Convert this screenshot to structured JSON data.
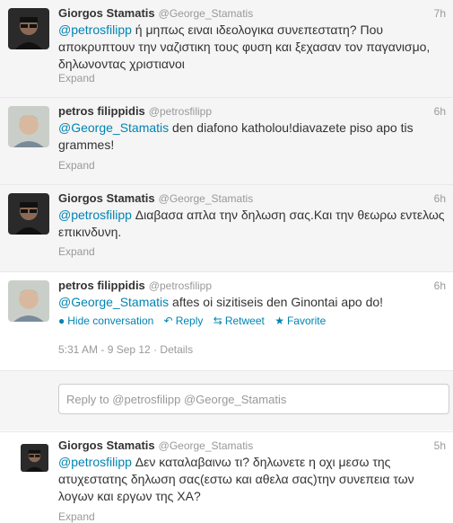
{
  "tweets": [
    {
      "name": "Giorgos Stamatis",
      "handle": "@George_Stamatis",
      "time": "7h",
      "mention": "@petrosfilipp",
      "text": " ή μηπως ειναι ιδεολογικα συνεπεστατη? Που αποκρυπτουν την ναζιστικη τους φυση και ξεχασαν τον παγανισμο, δηλωνοντας χριστιανοι",
      "expand": "Expand"
    },
    {
      "name": "petros filippidis",
      "handle": "@petrosfilipp",
      "time": "6h",
      "mention": "@George_Stamatis",
      "text": " den diafono katholou!diavazete piso apo tis grammes!",
      "expand": "Expand"
    },
    {
      "name": "Giorgos Stamatis",
      "handle": "@George_Stamatis",
      "time": "6h",
      "mention": "@petrosfilipp",
      "text": " Διαβασα απλα την δηλωση σας.Και την θεωρω εντελως επικινδυνη.",
      "expand": "Expand"
    },
    {
      "name": "petros filippidis",
      "handle": "@petrosfilipp",
      "time": "6h",
      "mention": "@George_Stamatis",
      "text": " aftes oi sizitiseis den Ginontai apo do!",
      "actions": {
        "hide": "Hide conversation",
        "reply": "Reply",
        "retweet": "Retweet",
        "favorite": "Favorite"
      },
      "meta": "5:31 AM - 9 Sep 12 · Details"
    },
    {
      "name": "Giorgos Stamatis",
      "handle": "@George_Stamatis",
      "time": "5h",
      "mention": "@petrosfilipp",
      "text": " Δεν καταλαβαινω τι? δηλωνετε η οχι μεσω της ατυχεστατης δηλωση σας(εστω και αθελα σας)την συνεπεια των λογων και εργων της ΧΑ?",
      "expand": "Expand"
    }
  ],
  "reply_box": {
    "placeholder": "Reply to @petrosfilipp @George_Stamatis"
  },
  "colors": {
    "link": "#0084b4",
    "muted": "#999999",
    "text": "#333333",
    "expanded_bg": "#f5f5f5"
  },
  "icons": {
    "hide": "speech-bubble-icon",
    "reply": "reply-arrow-icon",
    "retweet": "retweet-icon",
    "favorite": "star-icon"
  }
}
